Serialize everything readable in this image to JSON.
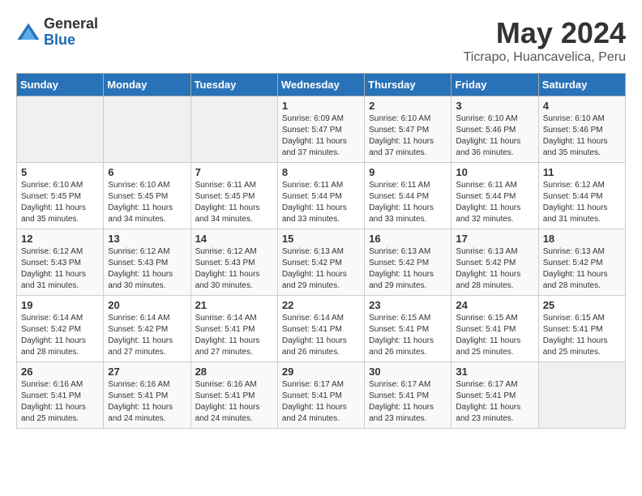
{
  "header": {
    "logo_general": "General",
    "logo_blue": "Blue",
    "month": "May 2024",
    "location": "Ticrapo, Huancavelica, Peru"
  },
  "days_of_week": [
    "Sunday",
    "Monday",
    "Tuesday",
    "Wednesday",
    "Thursday",
    "Friday",
    "Saturday"
  ],
  "weeks": [
    [
      {
        "num": "",
        "sunrise": "",
        "sunset": "",
        "daylight": ""
      },
      {
        "num": "",
        "sunrise": "",
        "sunset": "",
        "daylight": ""
      },
      {
        "num": "",
        "sunrise": "",
        "sunset": "",
        "daylight": ""
      },
      {
        "num": "1",
        "sunrise": "6:09 AM",
        "sunset": "5:47 PM",
        "daylight": "11 hours and 37 minutes."
      },
      {
        "num": "2",
        "sunrise": "6:10 AM",
        "sunset": "5:47 PM",
        "daylight": "11 hours and 37 minutes."
      },
      {
        "num": "3",
        "sunrise": "6:10 AM",
        "sunset": "5:46 PM",
        "daylight": "11 hours and 36 minutes."
      },
      {
        "num": "4",
        "sunrise": "6:10 AM",
        "sunset": "5:46 PM",
        "daylight": "11 hours and 35 minutes."
      }
    ],
    [
      {
        "num": "5",
        "sunrise": "6:10 AM",
        "sunset": "5:45 PM",
        "daylight": "11 hours and 35 minutes."
      },
      {
        "num": "6",
        "sunrise": "6:10 AM",
        "sunset": "5:45 PM",
        "daylight": "11 hours and 34 minutes."
      },
      {
        "num": "7",
        "sunrise": "6:11 AM",
        "sunset": "5:45 PM",
        "daylight": "11 hours and 34 minutes."
      },
      {
        "num": "8",
        "sunrise": "6:11 AM",
        "sunset": "5:44 PM",
        "daylight": "11 hours and 33 minutes."
      },
      {
        "num": "9",
        "sunrise": "6:11 AM",
        "sunset": "5:44 PM",
        "daylight": "11 hours and 33 minutes."
      },
      {
        "num": "10",
        "sunrise": "6:11 AM",
        "sunset": "5:44 PM",
        "daylight": "11 hours and 32 minutes."
      },
      {
        "num": "11",
        "sunrise": "6:12 AM",
        "sunset": "5:44 PM",
        "daylight": "11 hours and 31 minutes."
      }
    ],
    [
      {
        "num": "12",
        "sunrise": "6:12 AM",
        "sunset": "5:43 PM",
        "daylight": "11 hours and 31 minutes."
      },
      {
        "num": "13",
        "sunrise": "6:12 AM",
        "sunset": "5:43 PM",
        "daylight": "11 hours and 30 minutes."
      },
      {
        "num": "14",
        "sunrise": "6:12 AM",
        "sunset": "5:43 PM",
        "daylight": "11 hours and 30 minutes."
      },
      {
        "num": "15",
        "sunrise": "6:13 AM",
        "sunset": "5:42 PM",
        "daylight": "11 hours and 29 minutes."
      },
      {
        "num": "16",
        "sunrise": "6:13 AM",
        "sunset": "5:42 PM",
        "daylight": "11 hours and 29 minutes."
      },
      {
        "num": "17",
        "sunrise": "6:13 AM",
        "sunset": "5:42 PM",
        "daylight": "11 hours and 28 minutes."
      },
      {
        "num": "18",
        "sunrise": "6:13 AM",
        "sunset": "5:42 PM",
        "daylight": "11 hours and 28 minutes."
      }
    ],
    [
      {
        "num": "19",
        "sunrise": "6:14 AM",
        "sunset": "5:42 PM",
        "daylight": "11 hours and 28 minutes."
      },
      {
        "num": "20",
        "sunrise": "6:14 AM",
        "sunset": "5:42 PM",
        "daylight": "11 hours and 27 minutes."
      },
      {
        "num": "21",
        "sunrise": "6:14 AM",
        "sunset": "5:41 PM",
        "daylight": "11 hours and 27 minutes."
      },
      {
        "num": "22",
        "sunrise": "6:14 AM",
        "sunset": "5:41 PM",
        "daylight": "11 hours and 26 minutes."
      },
      {
        "num": "23",
        "sunrise": "6:15 AM",
        "sunset": "5:41 PM",
        "daylight": "11 hours and 26 minutes."
      },
      {
        "num": "24",
        "sunrise": "6:15 AM",
        "sunset": "5:41 PM",
        "daylight": "11 hours and 25 minutes."
      },
      {
        "num": "25",
        "sunrise": "6:15 AM",
        "sunset": "5:41 PM",
        "daylight": "11 hours and 25 minutes."
      }
    ],
    [
      {
        "num": "26",
        "sunrise": "6:16 AM",
        "sunset": "5:41 PM",
        "daylight": "11 hours and 25 minutes."
      },
      {
        "num": "27",
        "sunrise": "6:16 AM",
        "sunset": "5:41 PM",
        "daylight": "11 hours and 24 minutes."
      },
      {
        "num": "28",
        "sunrise": "6:16 AM",
        "sunset": "5:41 PM",
        "daylight": "11 hours and 24 minutes."
      },
      {
        "num": "29",
        "sunrise": "6:17 AM",
        "sunset": "5:41 PM",
        "daylight": "11 hours and 24 minutes."
      },
      {
        "num": "30",
        "sunrise": "6:17 AM",
        "sunset": "5:41 PM",
        "daylight": "11 hours and 23 minutes."
      },
      {
        "num": "31",
        "sunrise": "6:17 AM",
        "sunset": "5:41 PM",
        "daylight": "11 hours and 23 minutes."
      },
      {
        "num": "",
        "sunrise": "",
        "sunset": "",
        "daylight": ""
      }
    ]
  ],
  "labels": {
    "sunrise": "Sunrise:",
    "sunset": "Sunset:",
    "daylight": "Daylight hours"
  }
}
